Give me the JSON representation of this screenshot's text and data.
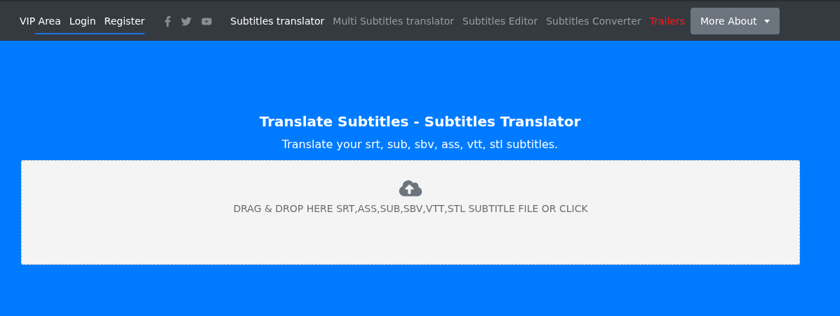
{
  "account_links": [
    {
      "label": "VIP Area"
    },
    {
      "label": "Login"
    },
    {
      "label": "Register"
    }
  ],
  "nav": [
    {
      "label": "Subtitles translator",
      "selected": true,
      "kind": "link"
    },
    {
      "label": "Multi Subtitles translator",
      "selected": false,
      "kind": "link"
    },
    {
      "label": "Subtitles Editor",
      "selected": false,
      "kind": "link"
    },
    {
      "label": "Subtitles Converter",
      "selected": false,
      "kind": "link"
    },
    {
      "label": "Trailers",
      "selected": false,
      "kind": "highlight"
    }
  ],
  "more_button": {
    "label": "More About"
  },
  "hero": {
    "title": "Translate Subtitles - Subtitles Translator",
    "subtitle": "Translate your srt, sub, sbv, ass, vtt, stl subtitles."
  },
  "dropzone": {
    "text": "DRAG & DROP HERE SRT,ASS,SUB,SBV,VTT,STL SUBTITLE FILE OR CLICK"
  }
}
